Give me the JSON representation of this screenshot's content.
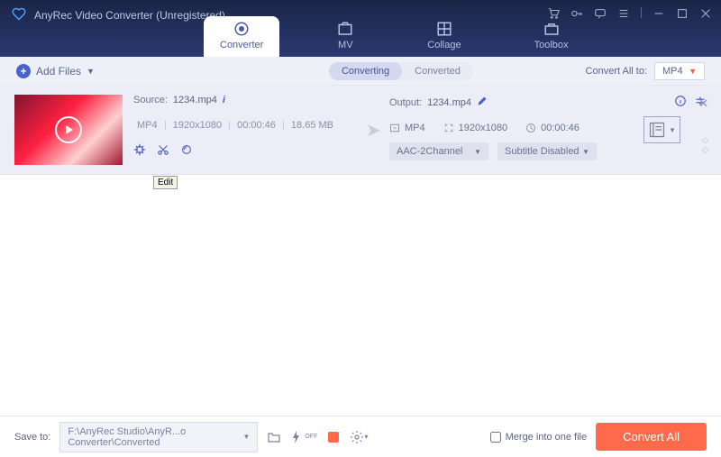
{
  "app": {
    "title": "AnyRec Video Converter (Unregistered)"
  },
  "nav": {
    "converter": "Converter",
    "mv": "MV",
    "collage": "Collage",
    "toolbox": "Toolbox"
  },
  "toolbar": {
    "add_files": "Add Files",
    "converting": "Converting",
    "converted": "Converted",
    "convert_all_to": "Convert All to:",
    "format": "MP4"
  },
  "item": {
    "source_label": "Source:",
    "source_file": "1234.mp4",
    "format": "MP4",
    "resolution": "1920x1080",
    "duration": "00:00:46",
    "size": "18.65 MB",
    "edit_tooltip": "Edit",
    "output_label": "Output:",
    "output_file": "1234.mp4",
    "out_format": "MP4",
    "out_resolution": "1920x1080",
    "out_duration": "00:00:46",
    "audio": "AAC-2Channel",
    "subtitle": "Subtitle Disabled"
  },
  "footer": {
    "save_to": "Save to:",
    "path": "F:\\AnyRec Studio\\AnyR...o Converter\\Converted",
    "merge": "Merge into one file",
    "convert_all": "Convert All"
  }
}
